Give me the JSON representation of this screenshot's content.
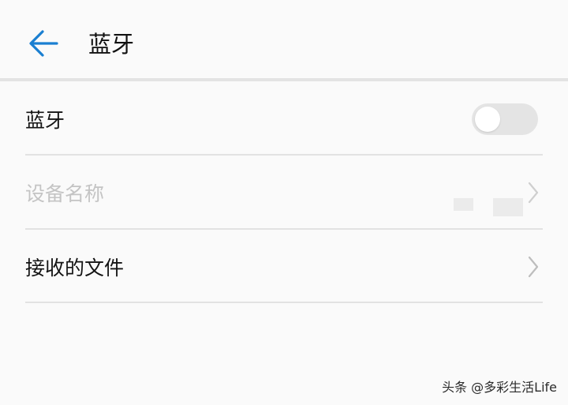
{
  "header": {
    "title": "蓝牙",
    "back_icon": "arrow-left-icon",
    "accent_color": "#1a7fd1"
  },
  "rows": [
    {
      "label": "蓝牙",
      "control": "toggle",
      "toggle_on": false
    },
    {
      "label": "设备名称",
      "control": "chevron",
      "disabled": true,
      "value_redacted": true
    },
    {
      "label": "接收的文件",
      "control": "chevron"
    }
  ],
  "icons": {
    "chevron": "chevron-right-icon"
  },
  "watermark": "头条 @多彩生活Life"
}
